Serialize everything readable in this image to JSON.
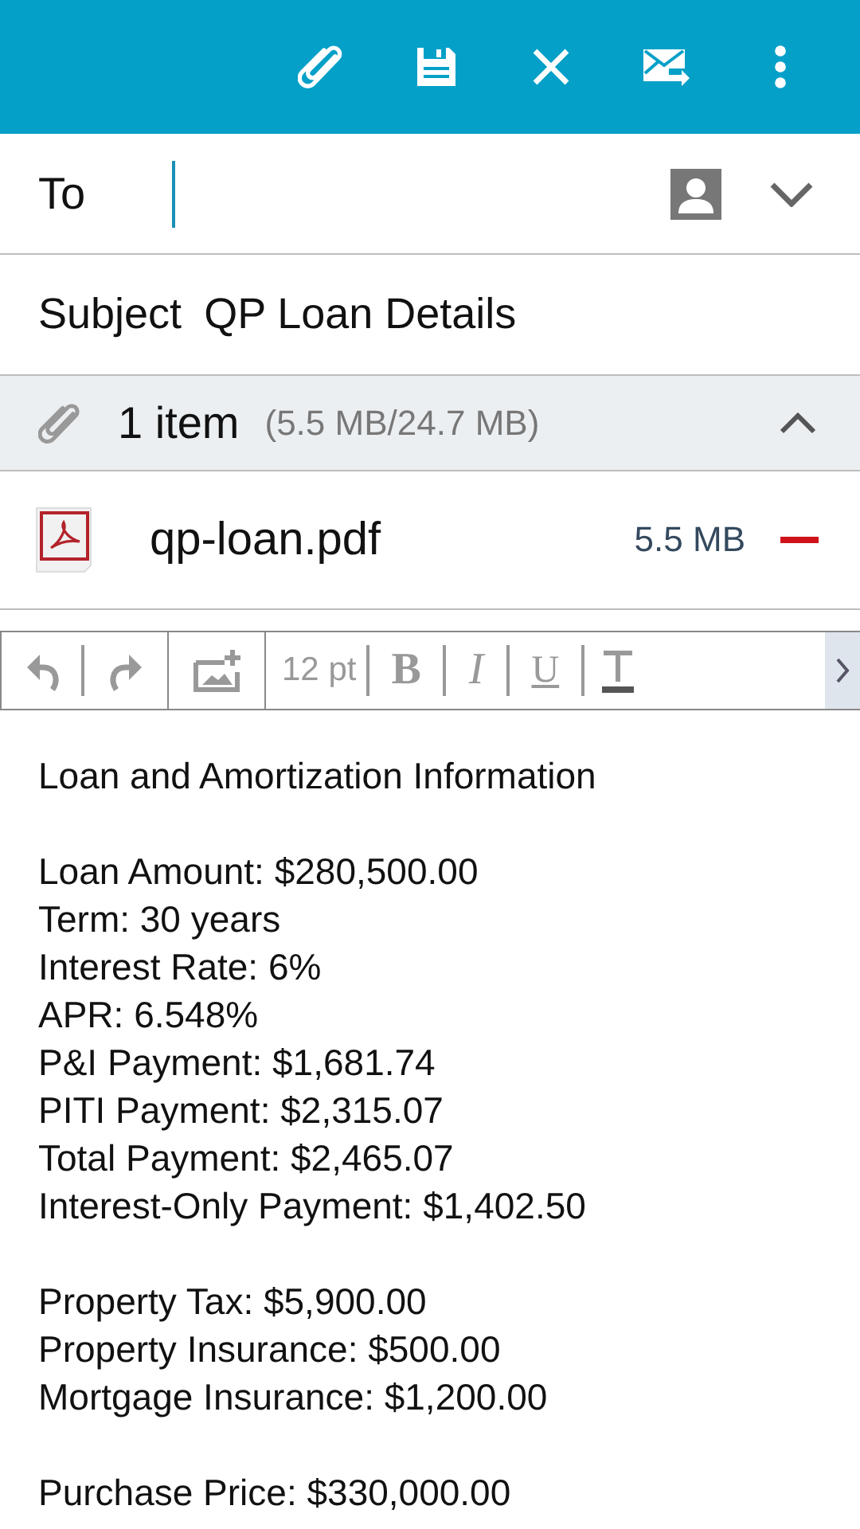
{
  "app_bar": {
    "actions": [
      {
        "kind": "attach"
      },
      {
        "kind": "save"
      },
      {
        "kind": "close"
      },
      {
        "kind": "send"
      },
      {
        "kind": "more"
      }
    ]
  },
  "to_field": {
    "label": "To"
  },
  "subject_field": {
    "label": "Subject",
    "value": "QP Loan Details"
  },
  "attachments": {
    "count": "1 item",
    "size": "(5.5 MB/24.7 MB)",
    "expanded": true,
    "files": [
      {
        "name": "qp-loan.pdf",
        "size": "5.5 MB"
      }
    ]
  },
  "format_toolbar": {
    "items": [
      {
        "kind": "undo"
      },
      {
        "kind": "redo"
      },
      {
        "kind": "image"
      },
      {
        "kind": "font_size",
        "label": "12 pt"
      },
      {
        "kind": "bold",
        "label": "B"
      },
      {
        "kind": "italic",
        "label": "I"
      },
      {
        "kind": "underline",
        "label": "U"
      },
      {
        "kind": "textcolor"
      }
    ]
  },
  "body": {
    "paragraphs": [
      [
        "Loan and Amortization Information"
      ],
      [
        "Loan Amount: $280,500.00",
        "Term: 30 years",
        "Interest Rate: 6%",
        "APR: 6.548%",
        "P&I Payment: $1,681.74",
        "PITI Payment: $2,315.07",
        "Total Payment: $2,465.07",
        "Interest-Only Payment: $1,402.50"
      ],
      [
        "Property Tax: $5,900.00",
        "Property Insurance: $500.00",
        "Mortgage Insurance: $1,200.00"
      ],
      [
        "Purchase Price: $330,000.00"
      ]
    ]
  }
}
